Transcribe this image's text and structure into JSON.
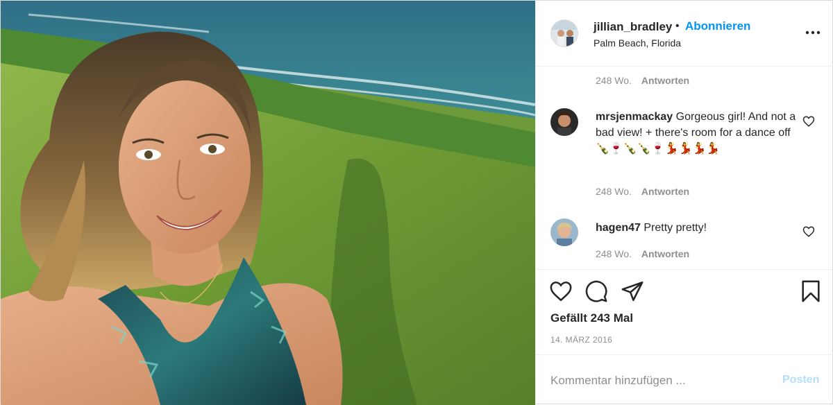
{
  "post": {
    "username": "jillian_bradley",
    "follow_label": "Abonnieren",
    "separator": "•",
    "location": "Palm Beach, Florida"
  },
  "comments": {
    "top_meta": {
      "age": "248 Wo.",
      "reply_label": "Antworten"
    },
    "items": [
      {
        "username": "mrsjenmackay",
        "text": "Gorgeous girl! And not a bad view! + there's room for a dance off 🍾🍷🍾🍾🍷💃💃💃💃",
        "age": "248 Wo.",
        "reply_label": "Antworten"
      },
      {
        "username": "hagen47",
        "text": "Pretty pretty!",
        "age": "248 Wo.",
        "reply_label": "Antworten"
      }
    ]
  },
  "actions": {
    "icons": [
      "heart-icon",
      "comment-icon",
      "share-icon",
      "bookmark-icon"
    ],
    "likes": "Gefällt 243 Mal",
    "date": "14. MÄRZ 2016"
  },
  "composer": {
    "placeholder": "Kommentar hinzufügen ...",
    "post_label": "Posten"
  },
  "colors": {
    "accent": "#0095f6",
    "post_disabled": "#b2dffc",
    "muted": "#8e8e8e",
    "text": "#262626"
  }
}
